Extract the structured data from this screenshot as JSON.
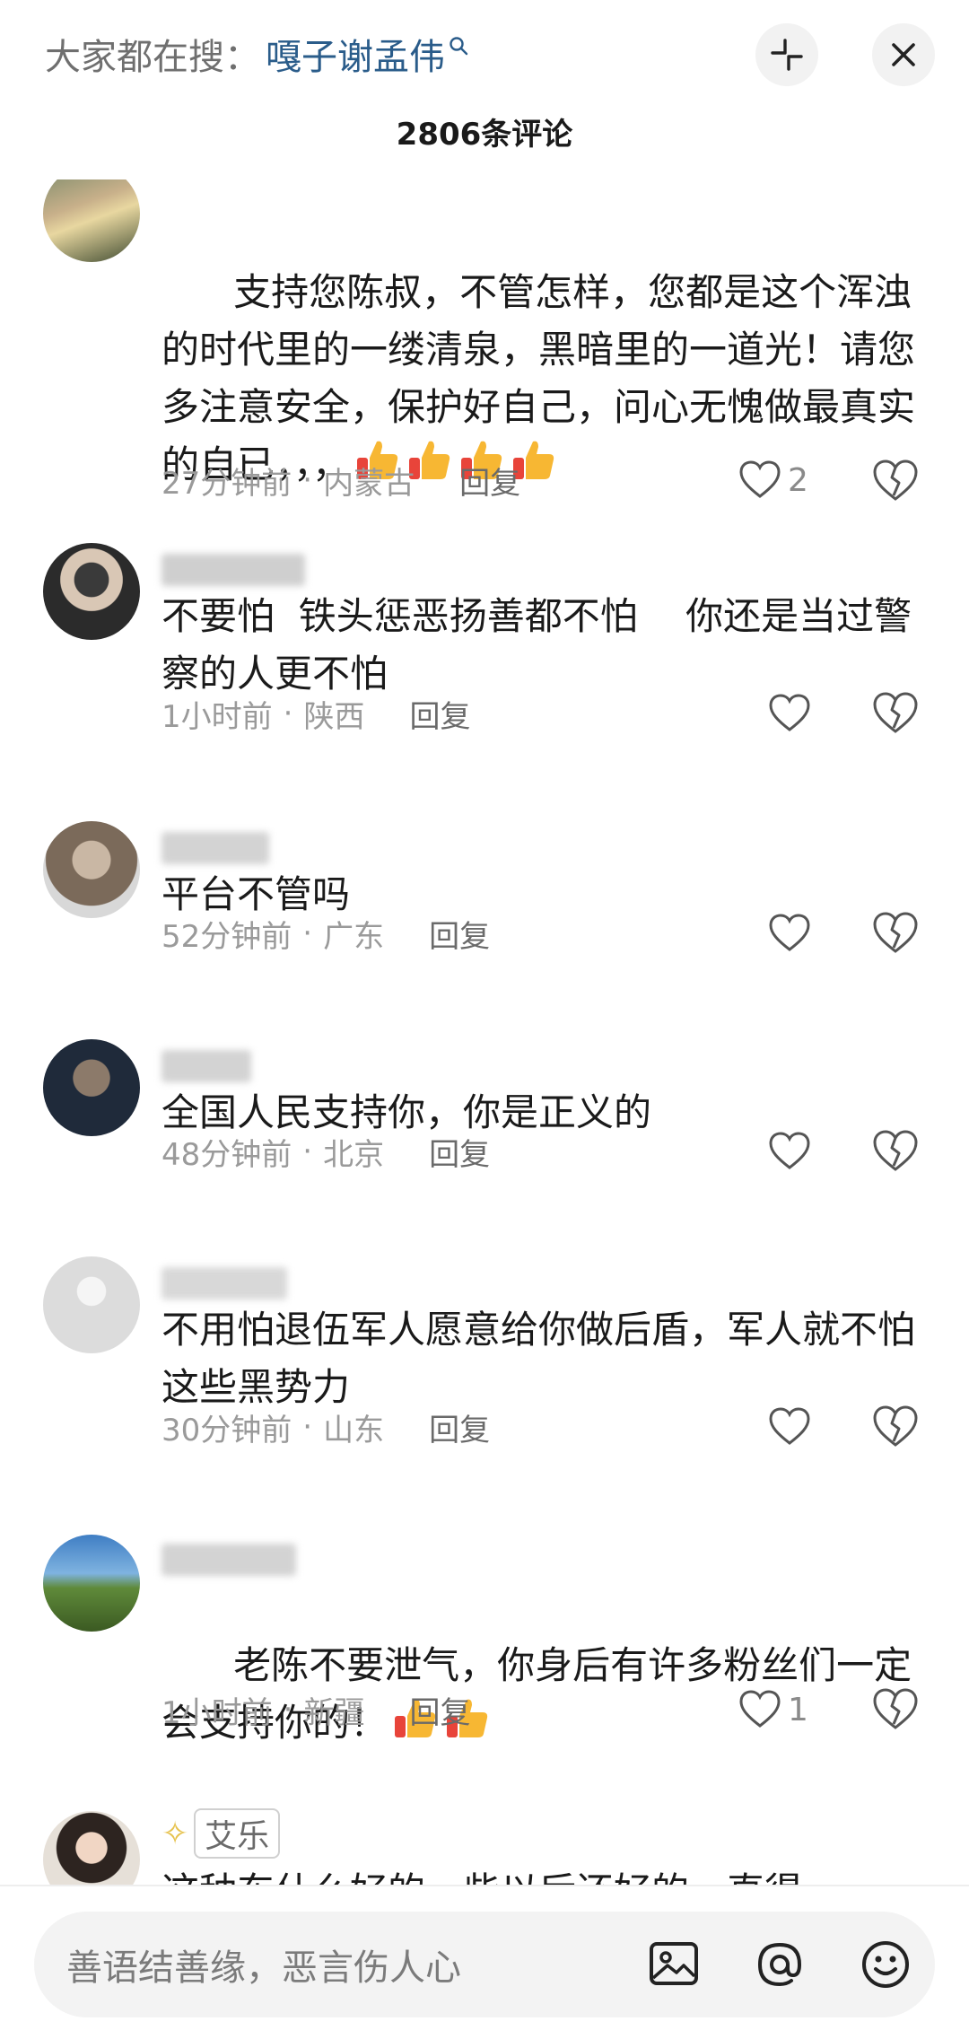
{
  "header": {
    "search_prefix": "大家都在搜：",
    "search_keyword": "嘎子谢孟伟",
    "comment_count": "2806条评论"
  },
  "comments": [
    {
      "text": "支持您陈叔，不管怎样，您都是这个浑浊的时代里的一缕清泉，黑暗里的一道光！请您多注意安全，保护好自己，问心无愧做最真实的自已，，，",
      "thumbs": 4,
      "time": "27分钟前",
      "location": "内蒙古",
      "reply": "回复",
      "likes": "2"
    },
    {
      "text": "不要怕  铁头惩恶扬善都不怕    你还是当过警察的人更不怕",
      "time": "1小时前",
      "location": "陕西",
      "reply": "回复",
      "likes": ""
    },
    {
      "text": "平台不管吗",
      "time": "52分钟前",
      "location": "广东",
      "reply": "回复",
      "likes": ""
    },
    {
      "text": "全国人民支持你，你是正义的",
      "time": "48分钟前",
      "location": "北京",
      "reply": "回复",
      "likes": ""
    },
    {
      "text": "不用怕退伍军人愿意给你做后盾，军人就不怕这些黑势力",
      "time": "30分钟前",
      "location": "山东",
      "reply": "回复",
      "likes": ""
    },
    {
      "text": "老陈不要泄气，你身后有许多粉丝们一定会支持你的！",
      "thumbs": 2,
      "time": "1小时前",
      "location": "新疆",
      "reply": "回复",
      "likes": "1"
    },
    {
      "username": "艾乐",
      "text": "这种东什么好的一些以后还好的一直得"
    }
  ],
  "input": {
    "placeholder": "善语结善缘，恶言伤人心"
  },
  "icons": {
    "collapse": "collapse-icon",
    "close": "close-icon",
    "search": "search-icon",
    "like": "heart-icon",
    "dislike": "broken-heart-icon",
    "image": "image-icon",
    "mention": "at-icon",
    "emoji": "emoji-icon"
  },
  "colors": {
    "keyword": "#2a5c8a",
    "meta": "#9a9a9a"
  }
}
